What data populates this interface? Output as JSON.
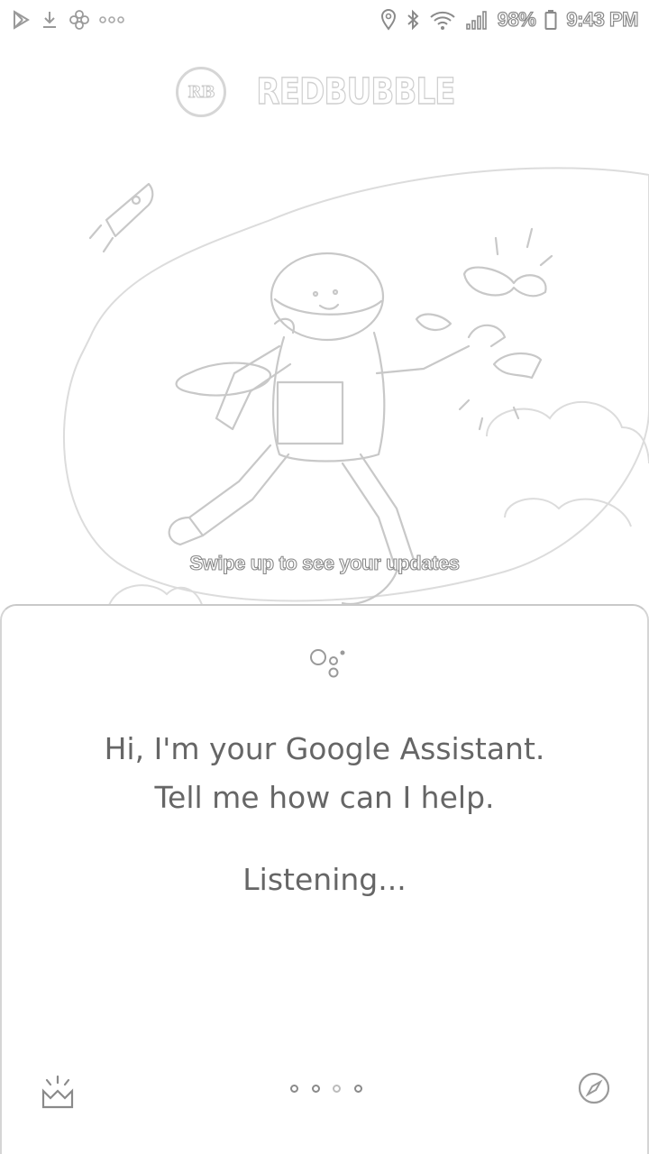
{
  "status_bar": {
    "left_icons": [
      "play-store-icon",
      "download-icon",
      "pinwheel-icon",
      "more-notifications-icon"
    ],
    "right_icons": [
      "location-icon",
      "bluetooth-icon",
      "wifi-icon",
      "signal-icon",
      "battery-icon"
    ],
    "battery_percent": "98%",
    "time": "9:43 PM"
  },
  "background_app": {
    "brand_logo_text": "RB",
    "brand_name": "REDBUBBLE",
    "swipe_hint": "Swipe up to see your updates"
  },
  "assistant": {
    "greeting_line1": "Hi, I'm your Google Assistant.",
    "greeting_line2": "Tell me how can I help.",
    "status": "Listening...",
    "bottom_bar": {
      "left_icon": "updates-tray-icon",
      "right_icon": "explore-compass-icon",
      "page_dots": 4
    }
  }
}
